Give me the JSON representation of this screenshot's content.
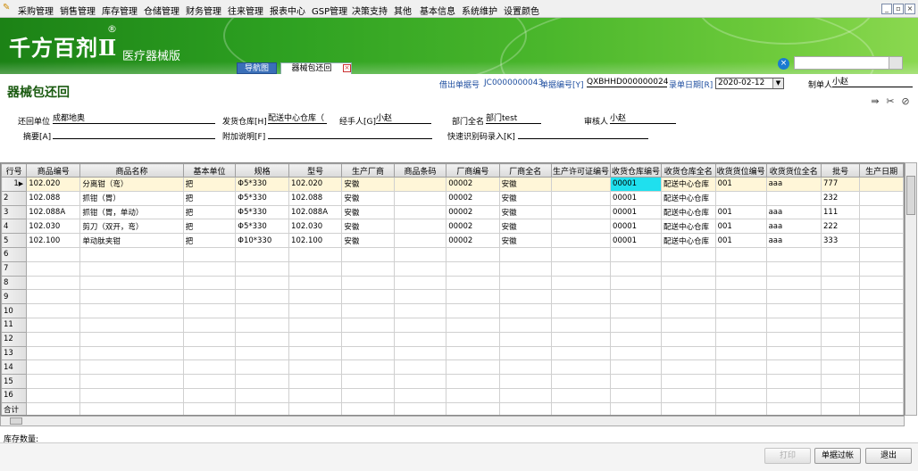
{
  "menu": [
    "采购管理",
    "销售管理",
    "库存管理",
    "仓储管理",
    "财务管理",
    "往来管理",
    "报表中心",
    "GSP管理",
    "决策支持",
    "其他",
    "基本信息",
    "系统维护",
    "设置颜色"
  ],
  "banner": {
    "logo": "千方百剂Ⅱ",
    "registered": "®",
    "edition": "医疗器械版"
  },
  "tabs": {
    "nav": "导航图",
    "form": "器械包还回"
  },
  "form": {
    "title": "器械包还回",
    "lend_no_label": "借出单据号",
    "lend_no_value": "JC0000000043",
    "doc_no_label": "单据编号[Y]",
    "doc_no_value": "QXBHHD000000024",
    "date_label": "录单日期[R]",
    "date_value": "2020-02-12",
    "maker_label": "制单人",
    "maker_value": "小赵",
    "return_unit_label": "还回单位",
    "return_unit_value": "成都地奥",
    "warehouse_label": "发货仓库[H]",
    "warehouse_value": "配送中心仓库（",
    "handler_label": "经手人[G]",
    "handler_value": "小赵",
    "dept_label": "部门全名",
    "dept_value": "部门test",
    "reviewer_label": "审核人",
    "reviewer_value": "小赵",
    "summary_label": "摘要[A]",
    "extra_label": "附加说明[F]",
    "barcode_label": "快速识别码录入[K]"
  },
  "grid": {
    "columns": [
      "行号",
      "商品编号",
      "商品名称",
      "基本单位",
      "规格",
      "型号",
      "生产厂商",
      "商品条码",
      "厂商编号",
      "厂商全名",
      "生产许可证编号",
      "收货仓库编号",
      "收货仓库全名",
      "收货货位编号",
      "收货货位全名",
      "批号",
      "生产日期"
    ],
    "rows": [
      [
        "1",
        "102.020",
        "分离钳（弯）",
        "把",
        "Φ5*330",
        "102.020",
        "安徽",
        "",
        "00002",
        "安徽",
        "",
        "00001",
        "配送中心仓库",
        "001",
        "aaa",
        "777",
        ""
      ],
      [
        "2",
        "102.088",
        "抓钳（胃）",
        "把",
        "Φ5*330",
        "102.088",
        "安徽",
        "",
        "00002",
        "安徽",
        "",
        "00001",
        "配送中心仓库",
        "",
        "",
        "232",
        ""
      ],
      [
        "3",
        "102.088A",
        "抓钳（胃，单动）",
        "把",
        "Φ5*330",
        "102.088A",
        "安徽",
        "",
        "00002",
        "安徽",
        "",
        "00001",
        "配送中心仓库",
        "001",
        "aaa",
        "111",
        ""
      ],
      [
        "4",
        "102.030",
        "剪刀（双开，弯）",
        "把",
        "Φ5*330",
        "102.030",
        "安徽",
        "",
        "00002",
        "安徽",
        "",
        "00001",
        "配送中心仓库",
        "001",
        "aaa",
        "222",
        ""
      ],
      [
        "5",
        "102.100",
        "单动肽夹钳",
        "把",
        "Φ10*330",
        "102.100",
        "安徽",
        "",
        "00002",
        "安徽",
        "",
        "00001",
        "配送中心仓库",
        "001",
        "aaa",
        "333",
        ""
      ],
      [
        "6"
      ],
      [
        "7"
      ],
      [
        "8"
      ],
      [
        "9"
      ],
      [
        "10"
      ],
      [
        "11"
      ],
      [
        "12"
      ],
      [
        "13"
      ],
      [
        "14"
      ],
      [
        "15"
      ],
      [
        "16"
      ],
      [
        "合计"
      ]
    ]
  },
  "footer": {
    "stock_label": "库存数量:"
  },
  "buttons": {
    "print": "打印",
    "filter": "单据过帐",
    "exit": "退出"
  }
}
